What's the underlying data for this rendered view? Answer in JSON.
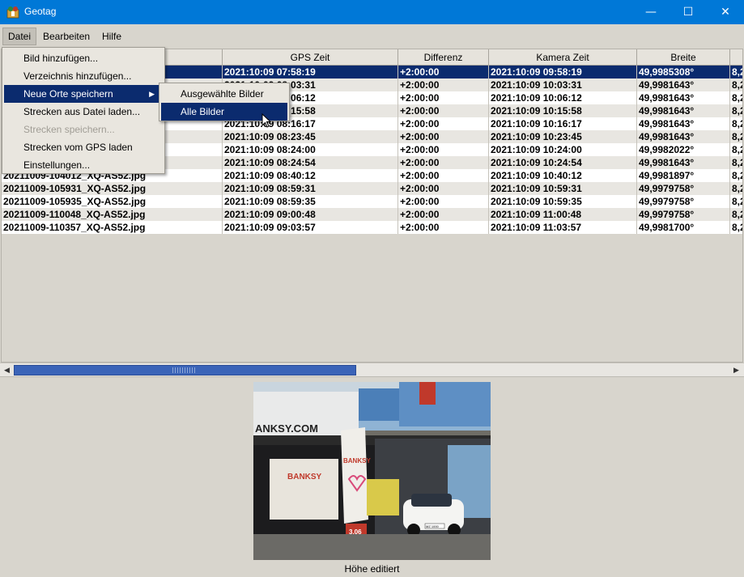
{
  "window": {
    "title": "Geotag",
    "minimize": "—",
    "maximize": "☐",
    "close": "✕"
  },
  "menubar": [
    "Datei",
    "Bearbeiten",
    "Hilfe"
  ],
  "table": {
    "columns": [
      "GPS Zeit",
      "Differenz",
      "Kamera Zeit",
      "Breite"
    ],
    "rows": [
      {
        "file": "",
        "gps": "2021:10:09 07:58:19",
        "diff": "+2:00:00",
        "cam": "2021:10:09 09:58:19",
        "lat": "49,9985308°",
        "lon": "8,2"
      },
      {
        "file": "",
        "gps": "2021:10:09 08:03:31",
        "diff": "+2:00:00",
        "cam": "2021:10:09 10:03:31",
        "lat": "49,9981643°",
        "lon": "8,2"
      },
      {
        "file": "",
        "gps": "2021:10:09 08:06:12",
        "diff": "+2:00:00",
        "cam": "2021:10:09 10:06:12",
        "lat": "49,9981643°",
        "lon": "8,2"
      },
      {
        "file": "",
        "gps": "2021:10:09 08:15:58",
        "diff": "+2:00:00",
        "cam": "2021:10:09 10:15:58",
        "lat": "49,9981643°",
        "lon": "8,2"
      },
      {
        "file": "",
        "gps": "2021:10:09 08:16:17",
        "diff": "+2:00:00",
        "cam": "2021:10:09 10:16:17",
        "lat": "49,9981643°",
        "lon": "8,2"
      },
      {
        "file": "",
        "gps": "2021:10:09 08:23:45",
        "diff": "+2:00:00",
        "cam": "2021:10:09 10:23:45",
        "lat": "49,9981643°",
        "lon": "8,2"
      },
      {
        "file": "",
        "gps": "2021:10:09 08:24:00",
        "diff": "+2:00:00",
        "cam": "2021:10:09 10:24:00",
        "lat": "49,9982022°",
        "lon": "8,2"
      },
      {
        "file": "",
        "gps": "2021:10:09 08:24:54",
        "diff": "+2:00:00",
        "cam": "2021:10:09 10:24:54",
        "lat": "49,9981643°",
        "lon": "8,2"
      },
      {
        "file": "20211009-104012_XQ-AS52.jpg",
        "gps": "2021:10:09 08:40:12",
        "diff": "+2:00:00",
        "cam": "2021:10:09 10:40:12",
        "lat": "49,9981897°",
        "lon": "8,2"
      },
      {
        "file": "20211009-105931_XQ-AS52.jpg",
        "gps": "2021:10:09 08:59:31",
        "diff": "+2:00:00",
        "cam": "2021:10:09 10:59:31",
        "lat": "49,9979758°",
        "lon": "8,2"
      },
      {
        "file": "20211009-105935_XQ-AS52.jpg",
        "gps": "2021:10:09 08:59:35",
        "diff": "+2:00:00",
        "cam": "2021:10:09 10:59:35",
        "lat": "49,9979758°",
        "lon": "8,2"
      },
      {
        "file": "20211009-110048_XQ-AS52.jpg",
        "gps": "2021:10:09 09:00:48",
        "diff": "+2:00:00",
        "cam": "2021:10:09 11:00:48",
        "lat": "49,9979758°",
        "lon": "8,2"
      },
      {
        "file": "20211009-110357_XQ-AS52.jpg",
        "gps": "2021:10:09 09:03:57",
        "diff": "+2:00:00",
        "cam": "2021:10:09 11:03:57",
        "lat": "49,9981700°",
        "lon": "8,2"
      }
    ]
  },
  "datei_menu": [
    {
      "label": "Bild hinzufügen...",
      "state": "normal"
    },
    {
      "label": "Verzeichnis hinzufügen...",
      "state": "normal"
    },
    {
      "label": "Neue Orte speichern",
      "state": "highlighted",
      "submenu": true
    },
    {
      "label": "Strecken aus Datei laden...",
      "state": "normal"
    },
    {
      "label": "Strecken speichern...",
      "state": "disabled"
    },
    {
      "label": "Strecken vom GPS laden",
      "state": "normal"
    },
    {
      "label": "Einstellungen...",
      "state": "normal"
    }
  ],
  "submenu": [
    {
      "label": "Ausgewählte Bilder",
      "state": "normal"
    },
    {
      "label": "Alle Bilder",
      "state": "highlighted"
    }
  ],
  "preview": {
    "sign_text": "ANKSY.COM",
    "exhibit_text": "BANKSY",
    "banner_text": "BANKSY",
    "sign_number": "3.06",
    "plate_text": "MZ 1000"
  },
  "status": "Höhe editiert",
  "colors": {
    "titlebar": "#0078d7",
    "selection": "#0b2b6e",
    "scroll_thumb": "#3b64b8"
  }
}
